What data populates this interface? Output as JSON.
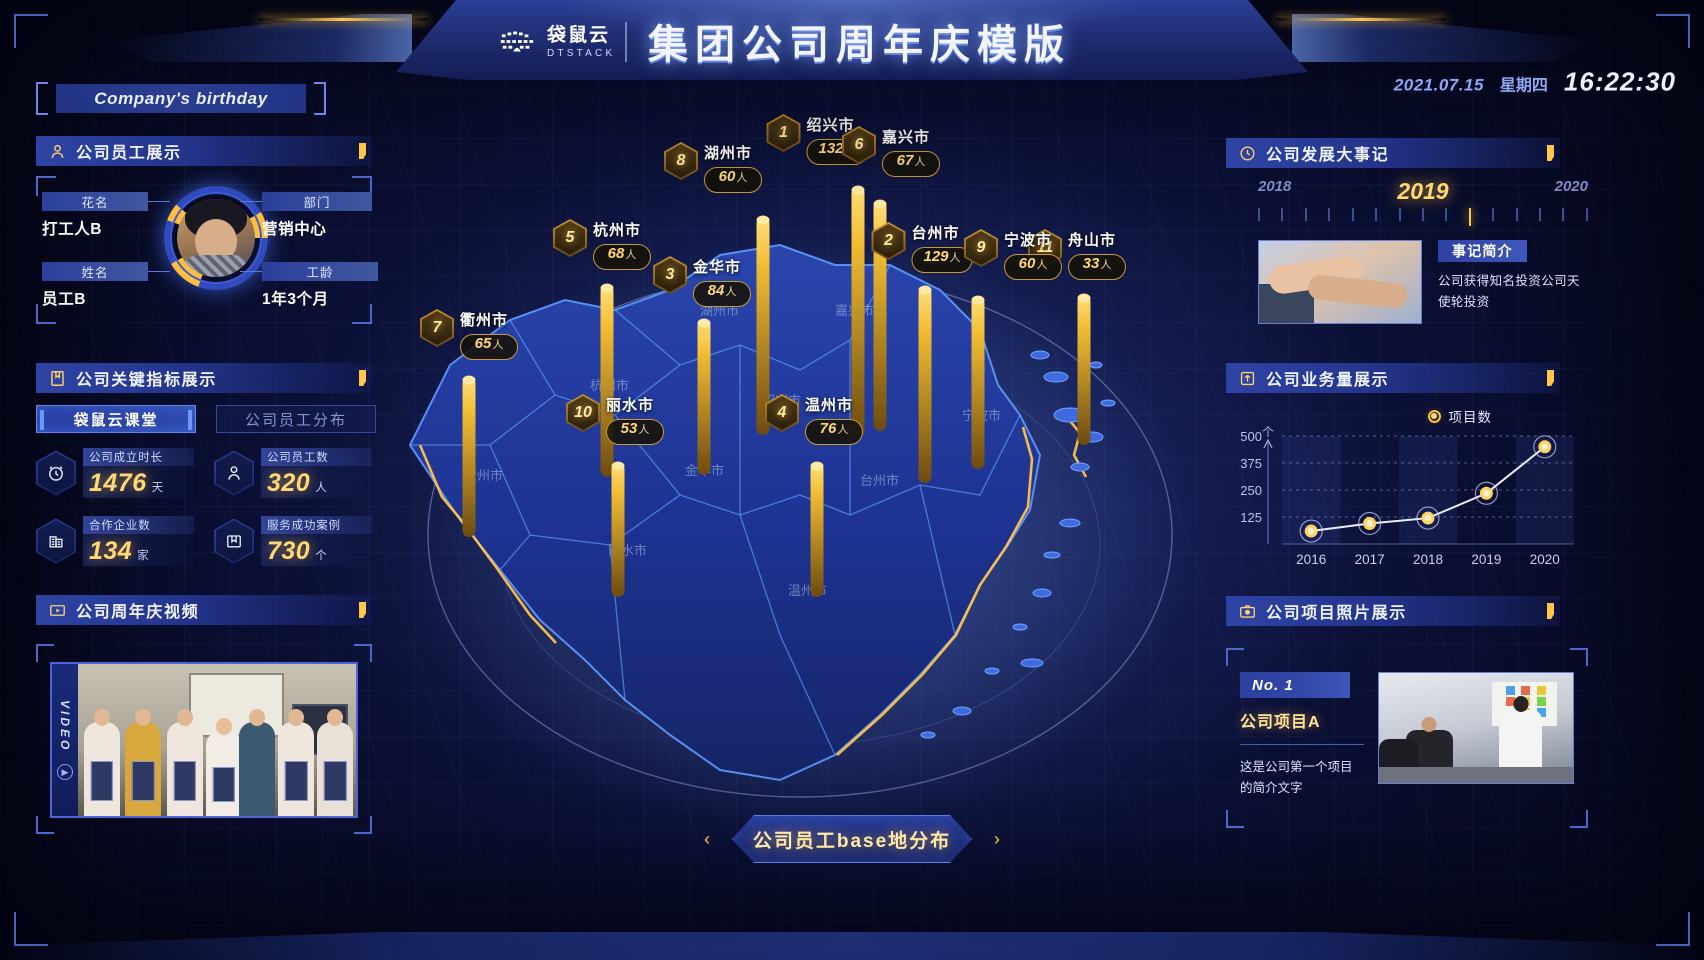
{
  "header": {
    "logo_cn": "袋鼠云",
    "logo_en": "DTSTACK",
    "title": "集团公司周年庆模版",
    "date": "2021.07.15",
    "weekday": "星期四",
    "time": "16:22:30"
  },
  "birthday_tag": "Company's birthday",
  "panels": {
    "employee": "公司员工展示",
    "metrics": "公司关键指标展示",
    "video": "公司周年庆视频",
    "events": "公司发展大事记",
    "business": "公司业务量展示",
    "project_photos": "公司项目照片展示"
  },
  "employee": {
    "nickname_label": "花名",
    "nickname_value": "打工人B",
    "dept_label": "部门",
    "dept_value": "营销中心",
    "name_label": "姓名",
    "name_value": "员工B",
    "tenure_label": "工龄",
    "tenure_value": "1年3个月"
  },
  "metrics": {
    "tabs": [
      {
        "label": "袋鼠云课堂",
        "active": true
      },
      {
        "label": "公司员工分布",
        "active": false
      }
    ],
    "items": [
      {
        "icon": "clock-icon",
        "label": "公司成立时长",
        "value": "1476",
        "unit": "天"
      },
      {
        "icon": "person-icon",
        "label": "公司员工数",
        "value": "320",
        "unit": "人"
      },
      {
        "icon": "building-icon",
        "label": "合作企业数",
        "value": "134",
        "unit": "家"
      },
      {
        "icon": "bookmark-icon",
        "label": "服务成功案例",
        "value": "730",
        "unit": "个"
      }
    ]
  },
  "video": {
    "side_label": "VIDEO"
  },
  "events": {
    "years": [
      "2018",
      "2019",
      "2020"
    ],
    "active_year": "2019",
    "brief_tag": "事记简介",
    "brief_text": "公司获得知名投资公司天使轮投资"
  },
  "chart_data": {
    "type": "line",
    "title": "公司业务量展示",
    "legend": [
      "项目数"
    ],
    "legend_position": "top-right",
    "categories": [
      "2016",
      "2017",
      "2018",
      "2019",
      "2020"
    ],
    "series": [
      {
        "name": "项目数",
        "values": [
          60,
          95,
          120,
          235,
          450
        ]
      }
    ],
    "x": [
      "2016",
      "2017",
      "2018",
      "2019",
      "2020"
    ],
    "xlabel": "",
    "ylabel": "个",
    "yticks": [
      0,
      125,
      250,
      375,
      500
    ],
    "ylim": [
      0,
      500
    ],
    "grid": true
  },
  "project": {
    "no_label": "No. 1",
    "name": "公司项目A",
    "desc": "这是公司第一个项目的简介文字"
  },
  "map": {
    "caption": "公司员工base地分布",
    "unit": "人",
    "cities": [
      {
        "rank": "1",
        "name": "绍兴市",
        "value": "132",
        "mx": 437,
        "my": 50,
        "bx": 478,
        "by": 72,
        "bh": 250
      },
      {
        "rank": "8",
        "name": "湖州市",
        "value": "60",
        "mx": 333,
        "my": 78,
        "bx": 383,
        "by": 102,
        "bh": 218
      },
      {
        "rank": "5",
        "name": "杭州市",
        "value": "68",
        "mx": 222,
        "my": 155,
        "bx": 227,
        "by": 170,
        "bh": 192
      },
      {
        "rank": "3",
        "name": "金华市",
        "value": "84",
        "mx": 322,
        "my": 192,
        "bx": 324,
        "by": 205,
        "bh": 155
      },
      {
        "rank": "2",
        "name": "台州市",
        "value": "129",
        "mx": 542,
        "my": 158,
        "bx": 545,
        "by": 172,
        "bh": 196
      },
      {
        "rank": "11",
        "name": "舟山市",
        "value": "33",
        "mx": 697,
        "my": 165,
        "bx": 704,
        "by": 180,
        "bh": 150
      },
      {
        "rank": "7",
        "name": "衢州市",
        "value": "65",
        "mx": 89,
        "my": 245,
        "bx": 89,
        "by": 262,
        "bh": 160
      },
      {
        "rank": "10",
        "name": "丽水市",
        "value": "53",
        "mx": 235,
        "my": 330,
        "bx": 238,
        "by": 348,
        "bh": 134
      },
      {
        "rank": "4",
        "name": "温州市",
        "value": "76",
        "mx": 434,
        "my": 330,
        "bx": 437,
        "by": 348,
        "bh": 134
      },
      {
        "rank": "6",
        "name": "嘉兴市",
        "value": "67",
        "mx": 511,
        "my": 62,
        "bx": 500,
        "by": 86,
        "bh": 230
      },
      {
        "rank": "9",
        "name": "宁波市",
        "value": "60",
        "mx": 633,
        "my": 165,
        "bx": 598,
        "by": 182,
        "bh": 172
      }
    ],
    "region_labels": [
      "湖州市",
      "嘉兴市",
      "杭州市",
      "绍兴市",
      "宁波市",
      "衢州市",
      "金华市",
      "台州市",
      "丽水市",
      "温州市"
    ]
  }
}
